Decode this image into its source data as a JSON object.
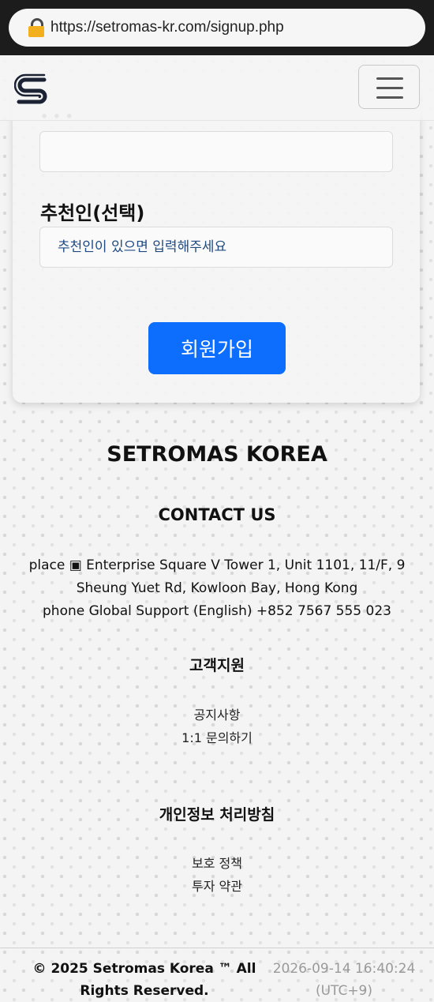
{
  "browser": {
    "url": "https://setromas-kr.com/signup.php"
  },
  "header": {
    "logo_icon": "setromas-s-logo",
    "menu_icon": "hamburger-menu-icon"
  },
  "form": {
    "partial_label": "• • •",
    "referrer_label": "추천인(선택)",
    "referrer_placeholder": "추천인이 있으면 입력해주세요",
    "submit_label": "회원가입"
  },
  "footer": {
    "brand": "SETROMAS KOREA",
    "contact_heading": "CONTACT US",
    "address_line": "place ▣ Enterprise Square V Tower 1, Unit 1101, 11/F, 9 Sheung Yuet Rd, Kowloon Bay, Hong Kong",
    "phone_line": "phone Global Support (English) +852 7567 555 023",
    "support_heading": "고객지원",
    "support_links": [
      "공지사항",
      "1:1 문의하기"
    ],
    "privacy_heading": "개인정보 처리방침",
    "privacy_links": [
      "보호 정책",
      "투자 약관"
    ],
    "copyright": "© 2025 Setromas Korea ™ All Rights Reserved.",
    "datetime": "2026-09-14 16:40:24",
    "timezone": "(UTC+9)"
  },
  "colors": {
    "primary_button": "#0d6efd",
    "placeholder_text": "#1f4a82"
  }
}
